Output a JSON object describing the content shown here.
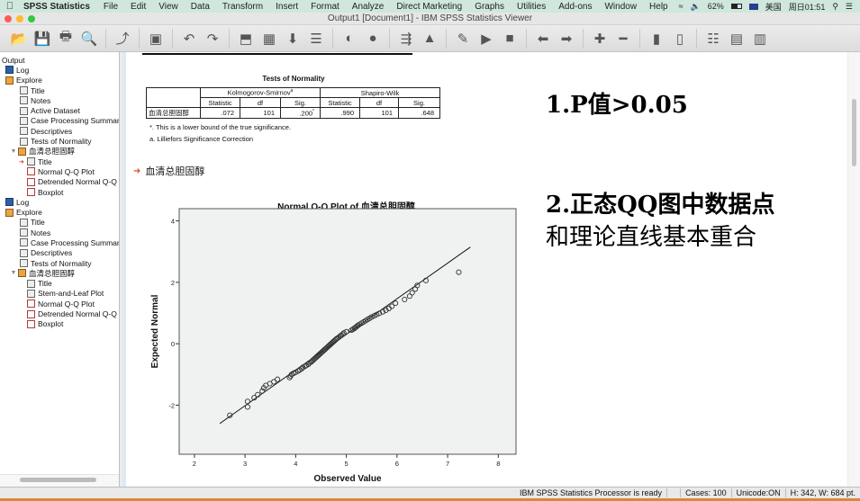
{
  "menubar": {
    "app_name": "SPSS Statistics",
    "items": [
      "File",
      "Edit",
      "View",
      "Data",
      "Transform",
      "Insert",
      "Format",
      "Analyze",
      "Direct Marketing",
      "Graphs",
      "Utilities",
      "Add-ons",
      "Window",
      "Help"
    ],
    "battery": "62%",
    "input_source": "美国",
    "clock": "周日01:51"
  },
  "window": {
    "title": "Output1 [Document1] - IBM SPSS Statistics Viewer"
  },
  "toolbar": {
    "buttons": [
      "open-icon",
      "save-icon",
      "print-icon",
      "print-preview-icon",
      "export-icon",
      "recall-dialog-icon",
      "undo-icon",
      "redo-icon",
      "goto-case-icon",
      "goto-variable-icon",
      "insert-cases-icon",
      "variables-icon",
      "split-file-icon",
      "weight-cases-icon",
      "select-cases-icon",
      "value-labels-icon",
      "scripts-icon",
      "run-icon",
      "stop-icon",
      "back-icon",
      "forward-icon",
      "expand-icon",
      "collapse-icon",
      "show-icon",
      "hide-icon",
      "insert-heading-icon",
      "insert-title-icon",
      "insert-text-icon"
    ]
  },
  "outline": {
    "root": "Output",
    "items": [
      {
        "label": "Log",
        "level": 1,
        "type": "log"
      },
      {
        "label": "Explore",
        "level": 1,
        "type": "exp"
      },
      {
        "label": "Title",
        "level": 2,
        "type": "doc"
      },
      {
        "label": "Notes",
        "level": 2,
        "type": "doc"
      },
      {
        "label": "Active Dataset",
        "level": 2,
        "type": "doc"
      },
      {
        "label": "Case Processing Summary",
        "level": 2,
        "type": "doc"
      },
      {
        "label": "Descriptives",
        "level": 2,
        "type": "doc"
      },
      {
        "label": "Tests of Normality",
        "level": 2,
        "type": "doc"
      },
      {
        "label": "血清总胆固醇",
        "level": 2,
        "type": "exp",
        "expanded": true
      },
      {
        "label": "Title",
        "level": 3,
        "type": "doc",
        "current": true
      },
      {
        "label": "Normal Q-Q Plot",
        "level": 3,
        "type": "chart"
      },
      {
        "label": "Detrended Normal Q-Q Plot",
        "level": 3,
        "type": "chart"
      },
      {
        "label": "Boxplot",
        "level": 3,
        "type": "chart"
      },
      {
        "label": "Log",
        "level": 1,
        "type": "log"
      },
      {
        "label": "Explore",
        "level": 1,
        "type": "exp"
      },
      {
        "label": "Title",
        "level": 2,
        "type": "doc"
      },
      {
        "label": "Notes",
        "level": 2,
        "type": "doc"
      },
      {
        "label": "Case Processing Summary",
        "level": 2,
        "type": "doc"
      },
      {
        "label": "Descriptives",
        "level": 2,
        "type": "doc"
      },
      {
        "label": "Tests of Normality",
        "level": 2,
        "type": "doc"
      },
      {
        "label": "血清总胆固醇",
        "level": 2,
        "type": "exp",
        "expanded": true
      },
      {
        "label": "Title",
        "level": 3,
        "type": "doc"
      },
      {
        "label": "Stem-and-Leaf Plot",
        "level": 3,
        "type": "doc"
      },
      {
        "label": "Normal Q-Q Plot",
        "level": 3,
        "type": "chart"
      },
      {
        "label": "Detrended Normal Q-Q Plot",
        "level": 3,
        "type": "chart"
      },
      {
        "label": "Boxplot",
        "level": 3,
        "type": "chart"
      }
    ]
  },
  "normality_table": {
    "title": "Tests of Normality",
    "group_headers": [
      "Kolmogorov-Smirnov",
      "Shapiro-Wilk"
    ],
    "ks_superscript": "a",
    "sub_headers": [
      "Statistic",
      "df",
      "Sig.",
      "Statistic",
      "df",
      "Sig."
    ],
    "row_label": "血清总胆固醇",
    "values": [
      ".072",
      "101",
      ".200",
      ".990",
      "101",
      ".648"
    ],
    "sig_marker": "*",
    "footnotes": [
      "*. This is a lower bound of the true significance.",
      "a. Lilliefors Significance Correction"
    ]
  },
  "section_heading": "血清总胆固醇",
  "chart_data": {
    "type": "scatter",
    "title": "Normal Q-Q Plot of 血清总胆固醇",
    "xlabel": "Observed Value",
    "ylabel": "Expected Normal",
    "xlim": [
      1.7,
      8.35
    ],
    "ylim": [
      -3.6,
      4.4
    ],
    "xticks": [
      2,
      3,
      4,
      5,
      6,
      7,
      8
    ],
    "yticks": [
      4,
      2,
      0,
      -2
    ],
    "grid": false,
    "reference_line": [
      [
        2.5,
        -2.6
      ],
      [
        7.45,
        3.15
      ]
    ],
    "points": [
      [
        2.7,
        -2.33
      ],
      [
        3.05,
        -2.06
      ],
      [
        3.05,
        -1.88
      ],
      [
        3.18,
        -1.76
      ],
      [
        3.25,
        -1.66
      ],
      [
        3.34,
        -1.54
      ],
      [
        3.37,
        -1.44
      ],
      [
        3.41,
        -1.36
      ],
      [
        3.49,
        -1.3
      ],
      [
        3.57,
        -1.24
      ],
      [
        3.64,
        -1.16
      ],
      [
        3.88,
        -1.1
      ],
      [
        3.9,
        -1.05
      ],
      [
        3.92,
        -1.0
      ],
      [
        3.96,
        -0.96
      ],
      [
        4.0,
        -0.93
      ],
      [
        4.05,
        -0.89
      ],
      [
        4.08,
        -0.85
      ],
      [
        4.12,
        -0.81
      ],
      [
        4.14,
        -0.77
      ],
      [
        4.18,
        -0.74
      ],
      [
        4.21,
        -0.71
      ],
      [
        4.25,
        -0.67
      ],
      [
        4.27,
        -0.63
      ],
      [
        4.3,
        -0.6
      ],
      [
        4.32,
        -0.57
      ],
      [
        4.34,
        -0.54
      ],
      [
        4.36,
        -0.51
      ],
      [
        4.38,
        -0.48
      ],
      [
        4.4,
        -0.45
      ],
      [
        4.42,
        -0.42
      ],
      [
        4.44,
        -0.39
      ],
      [
        4.46,
        -0.36
      ],
      [
        4.48,
        -0.33
      ],
      [
        4.5,
        -0.3
      ],
      [
        4.52,
        -0.27
      ],
      [
        4.54,
        -0.24
      ],
      [
        4.56,
        -0.21
      ],
      [
        4.58,
        -0.18
      ],
      [
        4.6,
        -0.15
      ],
      [
        4.62,
        -0.12
      ],
      [
        4.64,
        -0.09
      ],
      [
        4.66,
        -0.06
      ],
      [
        4.68,
        -0.03
      ],
      [
        4.7,
        0.0
      ],
      [
        4.72,
        0.03
      ],
      [
        4.74,
        0.06
      ],
      [
        4.76,
        0.09
      ],
      [
        4.78,
        0.12
      ],
      [
        4.8,
        0.15
      ],
      [
        4.82,
        0.18
      ],
      [
        4.85,
        0.21
      ],
      [
        4.88,
        0.25
      ],
      [
        4.9,
        0.28
      ],
      [
        4.93,
        0.31
      ],
      [
        4.95,
        0.35
      ],
      [
        5.0,
        0.39
      ],
      [
        5.1,
        0.44
      ],
      [
        5.13,
        0.47
      ],
      [
        5.16,
        0.5
      ],
      [
        5.18,
        0.53
      ],
      [
        5.21,
        0.57
      ],
      [
        5.23,
        0.6
      ],
      [
        5.26,
        0.63
      ],
      [
        5.3,
        0.67
      ],
      [
        5.34,
        0.71
      ],
      [
        5.38,
        0.75
      ],
      [
        5.42,
        0.79
      ],
      [
        5.46,
        0.83
      ],
      [
        5.5,
        0.87
      ],
      [
        5.55,
        0.91
      ],
      [
        5.6,
        0.95
      ],
      [
        5.65,
        0.99
      ],
      [
        5.72,
        1.04
      ],
      [
        5.78,
        1.09
      ],
      [
        5.84,
        1.15
      ],
      [
        5.9,
        1.22
      ],
      [
        5.97,
        1.32
      ],
      [
        6.15,
        1.44
      ],
      [
        6.25,
        1.55
      ],
      [
        6.3,
        1.66
      ],
      [
        6.36,
        1.78
      ],
      [
        6.4,
        1.9
      ],
      [
        6.57,
        2.06
      ],
      [
        7.22,
        2.33
      ]
    ]
  },
  "annotations": {
    "line1": "1.P值>0.05",
    "line2a": "2.正态QQ图中数据点",
    "line2b": "和理论直线基本重合"
  },
  "statusbar": {
    "processor": "IBM SPSS Statistics Processor is ready",
    "cases": "Cases: 100",
    "unicode": "Unicode:ON",
    "size": "H: 342, W: 684 pt."
  }
}
